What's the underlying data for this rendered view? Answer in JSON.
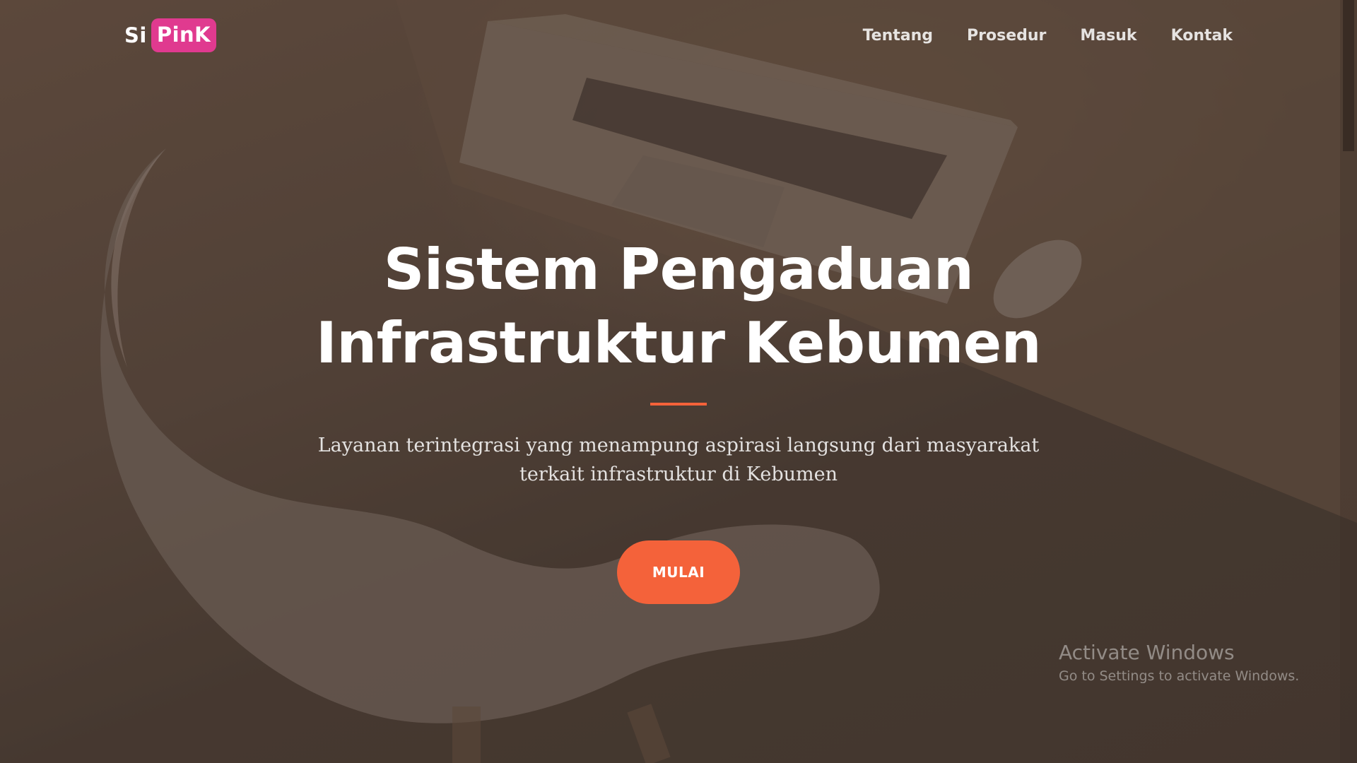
{
  "brand": {
    "prefix": "Si",
    "highlight": "PinK",
    "highlight_color": "#e03a8f"
  },
  "nav": {
    "items": [
      {
        "label": "Tentang"
      },
      {
        "label": "Prosedur"
      },
      {
        "label": "Masuk"
      },
      {
        "label": "Kontak"
      }
    ]
  },
  "hero": {
    "title_line1": "Sistem Pengaduan",
    "title_line2": "Infrastruktur Kebumen",
    "subtitle_line1": "Layanan terintegrasi yang menampung aspirasi langsung dari masyarakat",
    "subtitle_line2": "terkait infrastruktur di Kebumen",
    "cta_label": "MULAI",
    "accent_color": "#f4623a"
  },
  "watermark": {
    "title": "Activate Windows",
    "subtitle": "Go to Settings to activate Windows."
  }
}
